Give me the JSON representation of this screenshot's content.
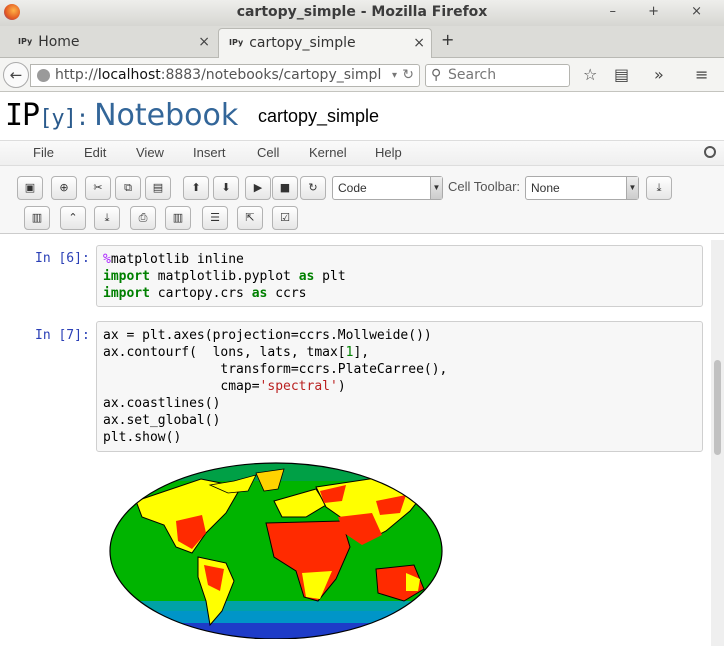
{
  "window": {
    "title": "cartopy_simple - Mozilla Firefox",
    "controls": "– + ×"
  },
  "tabs": [
    {
      "label": "Home",
      "favicon": "IPy"
    },
    {
      "label": "cartopy_simple",
      "favicon": "IPy"
    }
  ],
  "nav": {
    "url_prefix": "http://",
    "url_host": "localhost",
    "url_rest": ":8883/notebooks/cartopy_simpl",
    "search_placeholder": "Search"
  },
  "notebook": {
    "logo_ip": "IP",
    "logo_bracket": "[y]:",
    "logo_word": "Notebook",
    "name": "cartopy_simple"
  },
  "menu": [
    "File",
    "Edit",
    "View",
    "Insert",
    "Cell",
    "Kernel",
    "Help"
  ],
  "toolbar": {
    "cell_type": "Code",
    "cell_toolbar_label": "Cell Toolbar:",
    "cell_toolbar_value": "None"
  },
  "cells": [
    {
      "prompt": "In [6]:"
    },
    {
      "prompt": "In [7]:"
    }
  ],
  "colors": {
    "prompt": "#2a3fb6",
    "keyword": "#008000",
    "string": "#ba2121",
    "magic": "#aa22ff"
  }
}
